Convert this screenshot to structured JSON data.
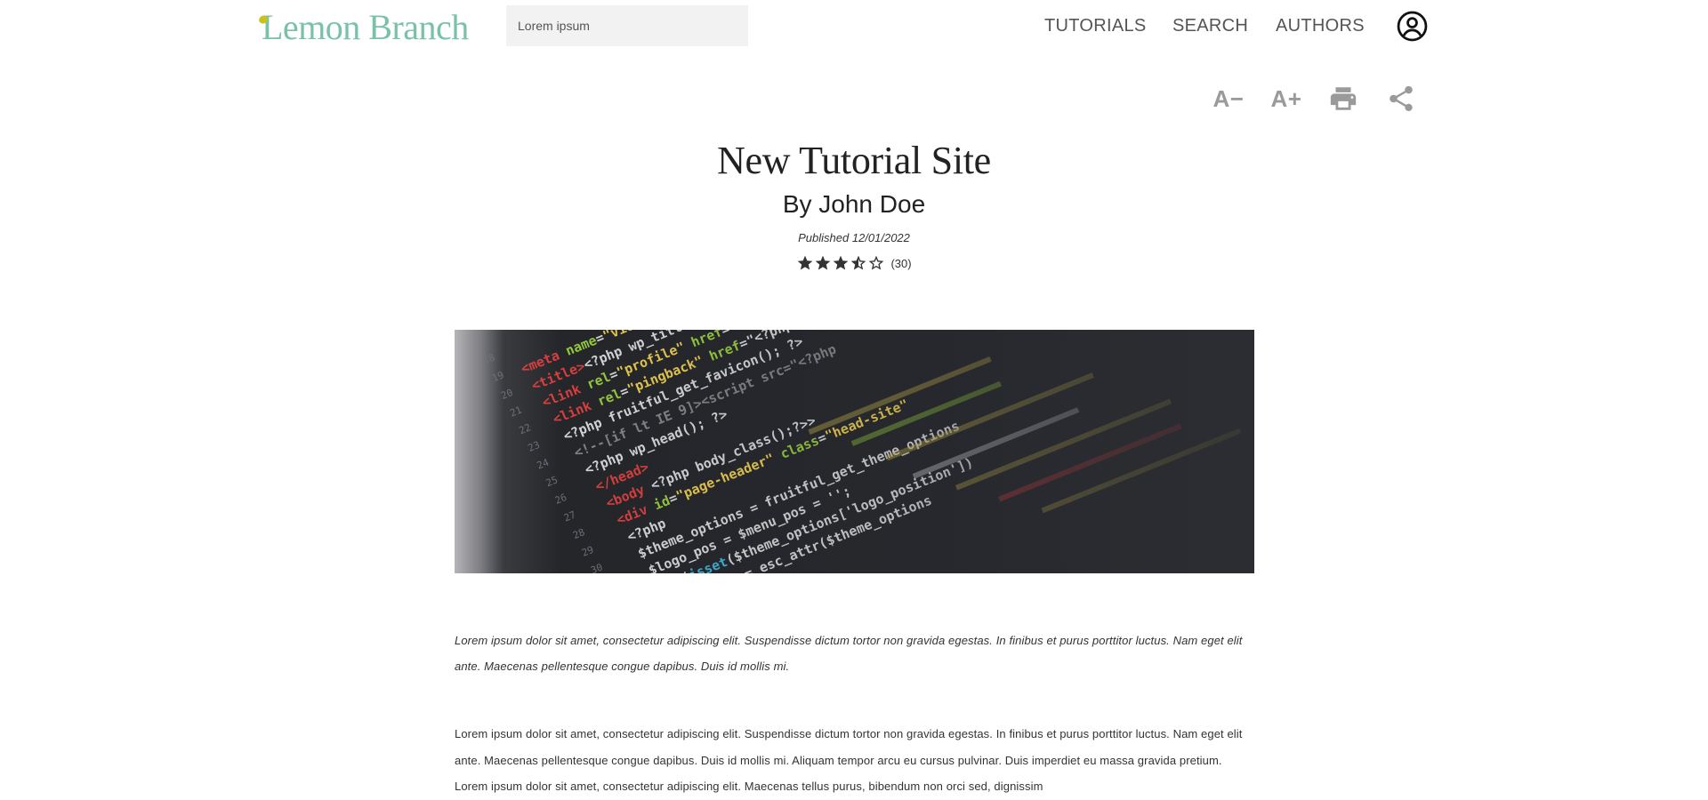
{
  "brand": {
    "name": "Lemon Branch",
    "leaf_color": "#c9c21c",
    "text_color": "#79c2a7"
  },
  "search": {
    "placeholder": "Lorem ipsum"
  },
  "nav": {
    "items": [
      {
        "label": "TUTORIALS"
      },
      {
        "label": "SEARCH"
      },
      {
        "label": "AUTHORS"
      }
    ],
    "account_icon": "account-circle-icon"
  },
  "toolbar": {
    "decrease_font_label": "A−",
    "increase_font_label": "A+",
    "print_icon": "print-icon",
    "share_icon": "share-icon",
    "icon_color": "#9a9a9a"
  },
  "article": {
    "title": "New Tutorial Site",
    "author": "By John Doe",
    "published": "Published 12/01/2022",
    "rating": {
      "value": 3.5,
      "max": 5,
      "count_label": "(30)"
    },
    "hero_image": "code-editor-screenshot",
    "lede": "Lorem ipsum dolor sit amet, consectetur adipiscing elit. Suspendisse dictum tortor non gravida egestas. In finibus et purus porttitor luctus. Nam eget elit ante. Maecenas pellentesque congue dapibus. Duis id mollis mi.",
    "body": "Lorem ipsum dolor sit amet, consectetur adipiscing elit. Suspendisse dictum tortor non gravida egestas. In finibus et purus porttitor luctus. Nam eget elit ante. Maecenas pellentesque congue dapibus. Duis id mollis mi. Aliquam tempor arcu eu cursus pulvinar. Duis imperdiet eu massa gravida pretium. Lorem ipsum dolor sit amet, consectetur adipiscing elit. Maecenas tellus purus, bibendum non orci sed, dignissim"
  }
}
